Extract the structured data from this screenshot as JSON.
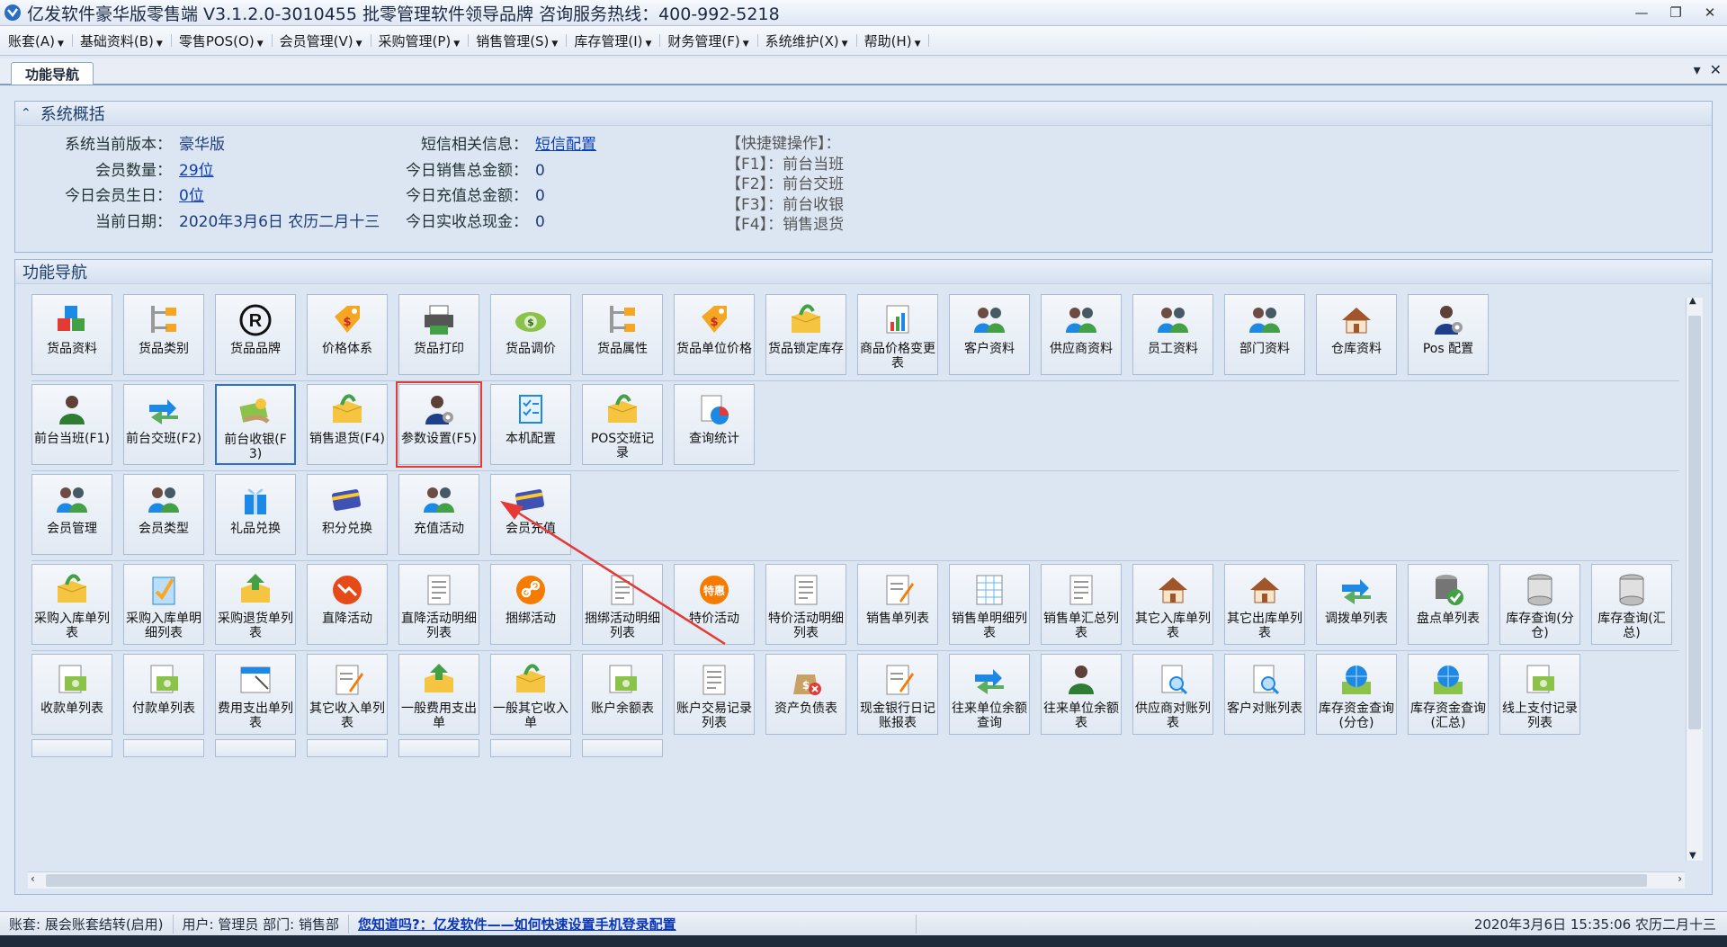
{
  "window": {
    "title": "亿发软件豪华版零售端 V3.1.2.0-3010455 批零管理软件领导品牌 咨询服务热线：400-992-5218",
    "min": "—",
    "restore": "❐",
    "close": "✕"
  },
  "menu": [
    "账套(A)",
    "基础资料(B)",
    "零售POS(O)",
    "会员管理(V)",
    "采购管理(P)",
    "销售管理(S)",
    "库存管理(I)",
    "财务管理(F)",
    "系统维护(X)",
    "帮助(H)"
  ],
  "tab": {
    "label": "功能导航"
  },
  "overview": {
    "heading": "系统概括",
    "col1": [
      {
        "label": "系统当前版本：",
        "value": "豪华版",
        "link": false
      },
      {
        "label": "会员数量：",
        "value": "29位",
        "link": true
      },
      {
        "label": "今日会员生日：",
        "value": "0位",
        "link": true
      },
      {
        "label": "当前日期：",
        "value": "2020年3月6日 农历二月十三",
        "link": false
      }
    ],
    "col2": [
      {
        "label": "短信相关信息：",
        "value": "短信配置",
        "link": true
      },
      {
        "label": "今日销售总金额：",
        "value": "0",
        "link": false
      },
      {
        "label": "今日充值总金额：",
        "value": "0",
        "link": false
      },
      {
        "label": "今日实收总现金：",
        "value": "0",
        "link": false
      }
    ],
    "shortcuts": [
      "【快捷键操作】：",
      "【F1】：前台当班",
      "【F2】：前台交班",
      "【F3】：前台收银",
      "【F4】：销售退货"
    ]
  },
  "nav": {
    "heading": "功能导航",
    "rows": [
      [
        {
          "label": "货品资料",
          "icon": "cubes"
        },
        {
          "label": "货品类别",
          "icon": "tree"
        },
        {
          "label": "货品品牌",
          "icon": "registered"
        },
        {
          "label": "价格体系",
          "icon": "price-tag"
        },
        {
          "label": "货品打印",
          "icon": "printer"
        },
        {
          "label": "货品调价",
          "icon": "money"
        },
        {
          "label": "货品属性",
          "icon": "tree"
        },
        {
          "label": "货品单位价格",
          "icon": "price-tag"
        },
        {
          "label": "货品锁定库存",
          "icon": "box"
        },
        {
          "label": "商品价格变更表",
          "icon": "chart-doc"
        },
        {
          "label": "客户资料",
          "icon": "people"
        },
        {
          "label": "供应商资料",
          "icon": "people"
        },
        {
          "label": "员工资料",
          "icon": "people"
        },
        {
          "label": "部门资料",
          "icon": "people"
        },
        {
          "label": "仓库资料",
          "icon": "house"
        },
        {
          "label": "Pos 配置",
          "icon": "user-gear"
        }
      ],
      [
        {
          "label": "前台当班(F1)",
          "icon": "user"
        },
        {
          "label": "前台交班(F2)",
          "icon": "arrows"
        },
        {
          "label": "前台收银(F3)",
          "icon": "cash",
          "selected": true
        },
        {
          "label": "销售退货(F4)",
          "icon": "box"
        },
        {
          "label": "参数设置(F5)",
          "icon": "user-gear",
          "highlight": true
        },
        {
          "label": "本机配置",
          "icon": "checklist"
        },
        {
          "label": "POS交班记录",
          "icon": "box"
        },
        {
          "label": "查询统计",
          "icon": "pie"
        }
      ],
      [
        {
          "label": "会员管理",
          "icon": "people"
        },
        {
          "label": "会员类型",
          "icon": "people"
        },
        {
          "label": "礼品兑换",
          "icon": "gift"
        },
        {
          "label": "积分兑换",
          "icon": "card"
        },
        {
          "label": "充值活动",
          "icon": "people"
        },
        {
          "label": "会员充值",
          "icon": "card"
        }
      ],
      [
        {
          "label": "采购入库单列表",
          "icon": "box"
        },
        {
          "label": "采购入库单明细列表",
          "icon": "clipboard"
        },
        {
          "label": "采购退货单列表",
          "icon": "box-up"
        },
        {
          "label": "直降活动",
          "icon": "down-badge"
        },
        {
          "label": "直降活动明细列表",
          "icon": "doc"
        },
        {
          "label": "捆绑活动",
          "icon": "link-badge"
        },
        {
          "label": "捆绑活动明细列表",
          "icon": "doc"
        },
        {
          "label": "特价活动",
          "icon": "special-badge"
        },
        {
          "label": "特价活动明细列表",
          "icon": "doc"
        },
        {
          "label": "销售单列表",
          "icon": "doc-pen"
        },
        {
          "label": "销售单明细列表",
          "icon": "doc-grid"
        },
        {
          "label": "销售单汇总列表",
          "icon": "doc"
        },
        {
          "label": "其它入库单列表",
          "icon": "house"
        },
        {
          "label": "其它出库单列表",
          "icon": "house"
        },
        {
          "label": "调拨单列表",
          "icon": "arrows"
        },
        {
          "label": "盘点单列表",
          "icon": "db-check"
        },
        {
          "label": "库存查询(分仓)",
          "icon": "db"
        },
        {
          "label": "库存查询(汇总)",
          "icon": "db"
        }
      ],
      [
        {
          "label": "收款单列表",
          "icon": "money-doc"
        },
        {
          "label": "付款单列表",
          "icon": "money-doc"
        },
        {
          "label": "费用支出单列表",
          "icon": "calendar"
        },
        {
          "label": "其它收入单列表",
          "icon": "doc-pen"
        },
        {
          "label": "一般费用支出单",
          "icon": "box-up"
        },
        {
          "label": "一般其它收入单",
          "icon": "box"
        },
        {
          "label": "账户余额表",
          "icon": "money-doc"
        },
        {
          "label": "账户交易记录列表",
          "icon": "doc"
        },
        {
          "label": "资产负债表",
          "icon": "bag"
        },
        {
          "label": "现金银行日记账报表",
          "icon": "doc-pen"
        },
        {
          "label": "往来单位余额查询",
          "icon": "arrows"
        },
        {
          "label": "往来单位余额表",
          "icon": "user"
        },
        {
          "label": "供应商对账列表",
          "icon": "doc-search"
        },
        {
          "label": "客户对账列表",
          "icon": "doc-search"
        },
        {
          "label": "库存资金查询(分仓)",
          "icon": "globe"
        },
        {
          "label": "库存资金查询(汇总)",
          "icon": "globe"
        },
        {
          "label": "线上支付记录列表",
          "icon": "money-doc"
        }
      ]
    ]
  },
  "status": {
    "account": "账套: 展会账套结转(启用)",
    "user": "用户: 管理员  部门: 销售部",
    "tip": "您知道吗?：亿发软件——如何快速设置手机登录配置",
    "time": "2020年3月6日 15:35:06 农历二月十三"
  }
}
